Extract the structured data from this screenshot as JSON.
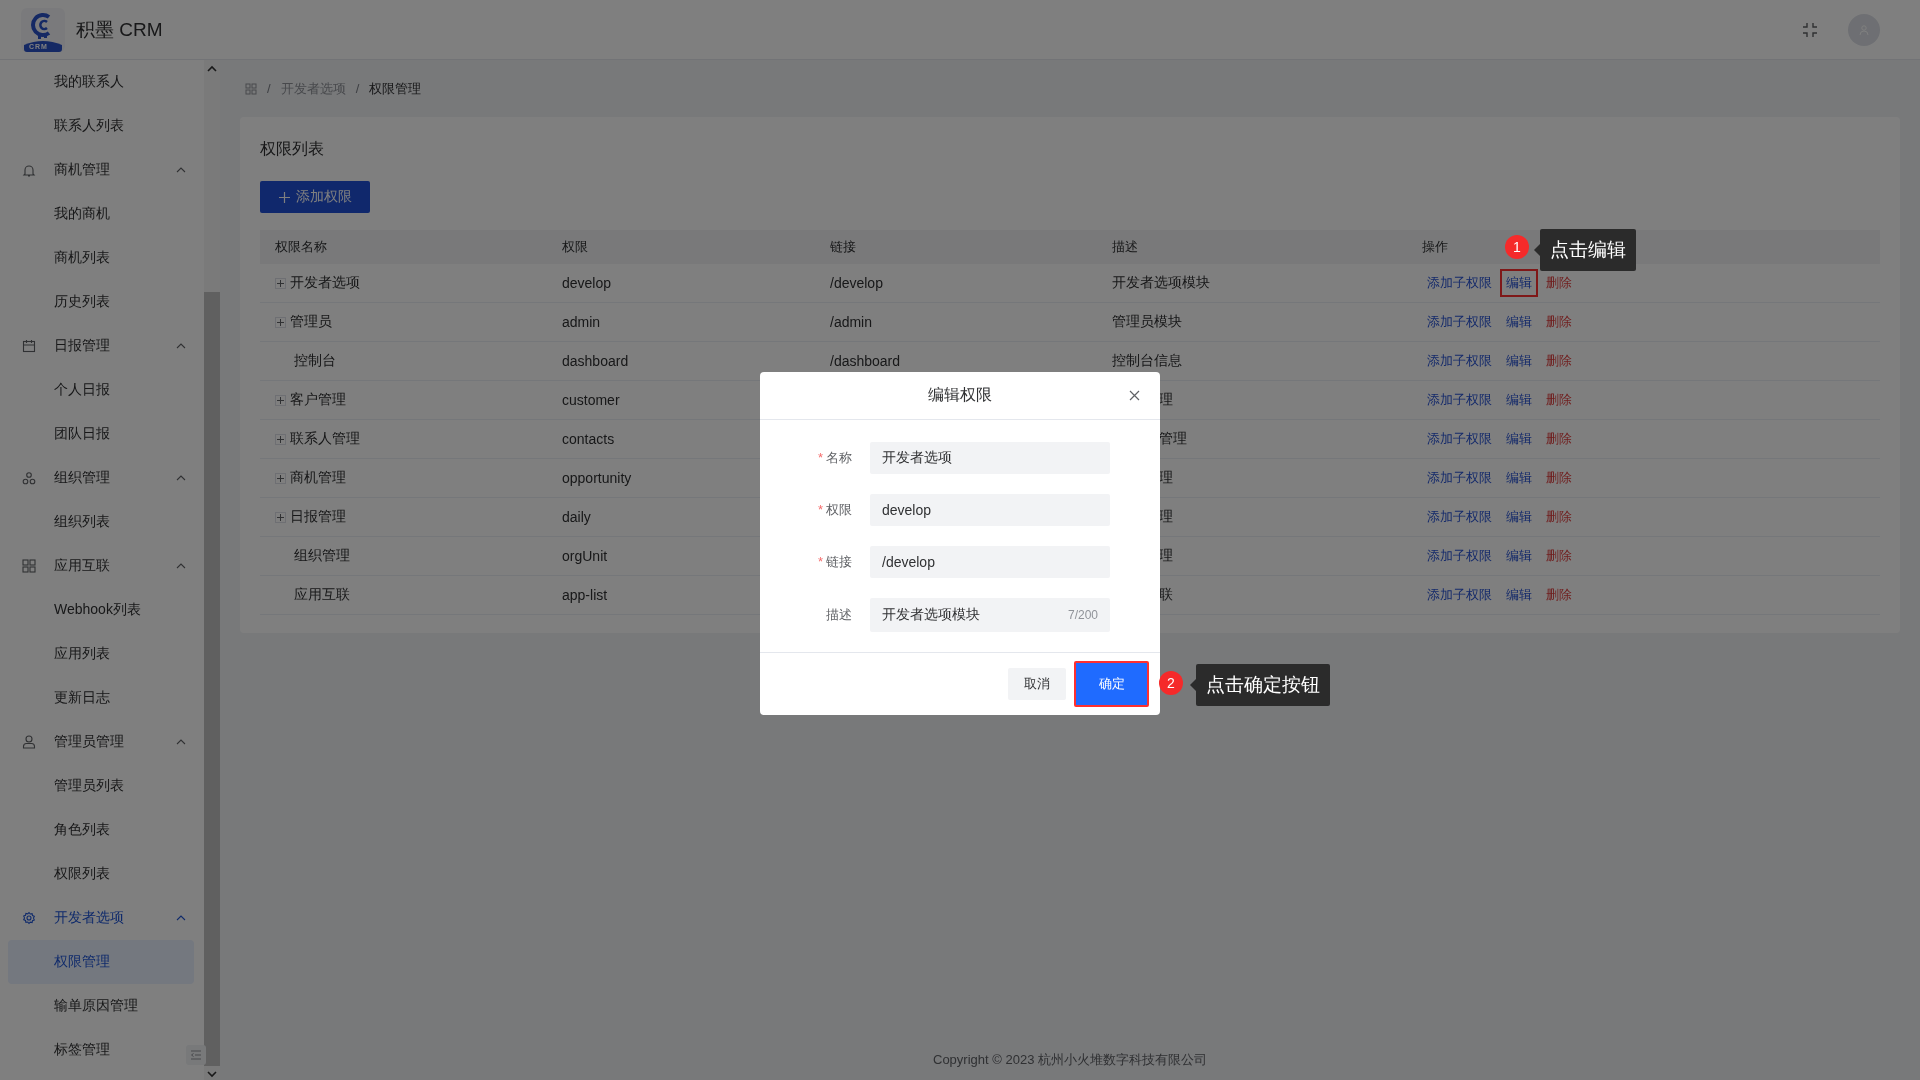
{
  "header": {
    "title": "积墨 CRM",
    "logo_text": "CRM"
  },
  "sidebar": {
    "items": [
      {
        "label": "我的联系人",
        "selected": false
      },
      {
        "label": "联系人列表",
        "selected": false
      },
      {
        "label": "商机管理",
        "selected": false,
        "expanded": true,
        "children": [
          {
            "label": "我的商机",
            "selected": false
          },
          {
            "label": "商机列表",
            "selected": false
          },
          {
            "label": "历史列表",
            "selected": false
          }
        ]
      },
      {
        "label": "日报管理",
        "selected": false,
        "expanded": true,
        "children": [
          {
            "label": "个人日报",
            "selected": false
          },
          {
            "label": "团队日报",
            "selected": false
          }
        ]
      },
      {
        "label": "组织管理",
        "selected": false,
        "expanded": true,
        "children": [
          {
            "label": "组织列表",
            "selected": false
          }
        ]
      },
      {
        "label": "应用互联",
        "selected": false,
        "expanded": true,
        "children": [
          {
            "label": "Webhook列表",
            "selected": false
          },
          {
            "label": "应用列表",
            "selected": false
          },
          {
            "label": "更新日志",
            "selected": false
          }
        ]
      },
      {
        "label": "管理员管理",
        "selected": false,
        "expanded": true,
        "children": [
          {
            "label": "管理员列表",
            "selected": false
          },
          {
            "label": "角色列表",
            "selected": false
          },
          {
            "label": "权限列表",
            "selected": false
          }
        ]
      },
      {
        "label": "开发者选项",
        "selected": true,
        "expanded": true,
        "children": [
          {
            "label": "权限管理",
            "selected": true
          },
          {
            "label": "输单原因管理",
            "selected": false
          },
          {
            "label": "标签管理",
            "selected": false
          }
        ]
      }
    ]
  },
  "breadcrumb": [
    {
      "separator": "/",
      "label": "开发者选项",
      "current": false
    },
    {
      "separator": "/",
      "label": "权限管理",
      "current": true
    }
  ],
  "card": {
    "title": "权限列表",
    "add_button": "添加权限"
  },
  "table": {
    "columns": [
      "权限名称",
      "权限",
      "链接",
      "描述",
      "操作"
    ],
    "rows": [
      {
        "name": "开发者选项",
        "expandable": true,
        "permission": "develop",
        "link": "/develop",
        "description": "开发者选项模块",
        "description_partial": false,
        "actions": [
          {
            "kind": "link",
            "label": "添加子权限",
            "highlighted": false
          },
          {
            "kind": "link",
            "label": "编辑",
            "highlighted": true
          },
          {
            "kind": "danger",
            "label": "删除",
            "highlighted": false
          }
        ]
      },
      {
        "name": "管理员",
        "expandable": true,
        "permission": "admin",
        "link": "/admin",
        "description": "管理员模块",
        "description_partial": false,
        "actions": [
          {
            "kind": "link",
            "label": "添加子权限",
            "highlighted": false
          },
          {
            "kind": "link",
            "label": "编辑",
            "highlighted": false
          },
          {
            "kind": "danger",
            "label": "删除",
            "highlighted": false
          }
        ]
      },
      {
        "name": "控制台",
        "expandable": false,
        "permission": "dashboard",
        "link": "/dashboard",
        "description": "控制台信息",
        "actions": [
          {
            "kind": "link",
            "label": "添加子权限",
            "highlighted": false
          },
          {
            "kind": "link",
            "label": "编辑",
            "highlighted": false
          },
          {
            "kind": "danger",
            "label": "删除",
            "highlighted": false
          }
        ]
      },
      {
        "name": "客户管理",
        "expandable": true,
        "permission": "customer",
        "description": "理",
        "description_partial": true,
        "actions": [
          {
            "kind": "link",
            "label": "添加子权限",
            "highlighted": false
          },
          {
            "kind": "link",
            "label": "编辑",
            "highlighted": false
          },
          {
            "kind": "danger",
            "label": "删除",
            "highlighted": false
          }
        ]
      },
      {
        "name": "联系人管理",
        "expandable": true,
        "permission": "contacts",
        "description": "管理",
        "description_partial": true,
        "actions": [
          {
            "kind": "link",
            "label": "添加子权限",
            "highlighted": false
          },
          {
            "kind": "link",
            "label": "编辑",
            "highlighted": false
          },
          {
            "kind": "danger",
            "label": "删除",
            "highlighted": false
          }
        ]
      },
      {
        "name": "商机管理",
        "expandable": true,
        "permission": "opportunity",
        "description": "理",
        "description_partial": true,
        "actions": [
          {
            "kind": "link",
            "label": "添加子权限",
            "highlighted": false
          },
          {
            "kind": "link",
            "label": "编辑",
            "highlighted": false
          },
          {
            "kind": "danger",
            "label": "删除",
            "highlighted": false
          }
        ]
      },
      {
        "name": "日报管理",
        "expandable": true,
        "permission": "daily",
        "description": "理",
        "description_partial": true,
        "actions": [
          {
            "kind": "link",
            "label": "添加子权限",
            "highlighted": false
          },
          {
            "kind": "link",
            "label": "编辑",
            "highlighted": false
          },
          {
            "kind": "danger",
            "label": "删除",
            "highlighted": false
          }
        ]
      },
      {
        "name": "组织管理",
        "expandable": false,
        "permission": "orgUnit",
        "description": "理",
        "description_partial": true,
        "actions": [
          {
            "kind": "link",
            "label": "添加子权限",
            "highlighted": false
          },
          {
            "kind": "link",
            "label": "编辑",
            "highlighted": false
          },
          {
            "kind": "danger",
            "label": "删除",
            "highlighted": false
          }
        ]
      },
      {
        "name": "应用互联",
        "expandable": false,
        "permission": "app-list",
        "description": "联",
        "description_partial": true,
        "actions": [
          {
            "kind": "link",
            "label": "添加子权限",
            "highlighted": false
          },
          {
            "kind": "link",
            "label": "编辑",
            "highlighted": false
          },
          {
            "kind": "danger",
            "label": "删除",
            "highlighted": false
          }
        ]
      }
    ]
  },
  "footer": "Copyright © 2023 杭州小火堆数字科技有限公司",
  "modal": {
    "title": "编辑权限",
    "fields": [
      {
        "label": "名称",
        "required_mark": "*",
        "value": "开发者选项"
      },
      {
        "label": "权限",
        "required_mark": "*",
        "value": "develop"
      },
      {
        "label": "链接",
        "required_mark": "*",
        "value": "/develop"
      },
      {
        "label": "描述",
        "value": "开发者选项模块",
        "counter": "7/200"
      }
    ],
    "buttons": [
      {
        "kind": "default",
        "label": "取消",
        "highlighted": false
      },
      {
        "kind": "primary",
        "label": "确定",
        "highlighted": true
      }
    ]
  },
  "annotations": [
    {
      "number": "1",
      "text": "点击编辑"
    },
    {
      "number": "2",
      "text": "点击确定按钮"
    }
  ]
}
